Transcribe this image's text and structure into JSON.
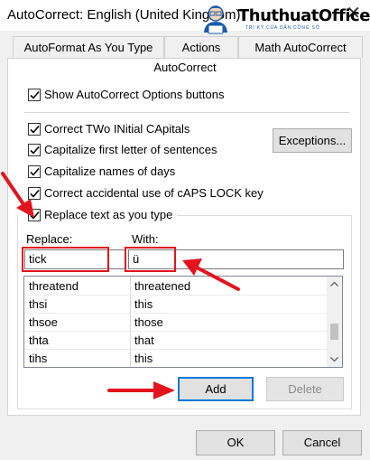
{
  "window": {
    "title": "AutoCorrect: English (United Kingdom)",
    "close_glyph": "✕"
  },
  "watermark": {
    "brand": "ThuthuatOffice",
    "tagline": "TRI KỶ CỦA DÂN CÔNG SỞ"
  },
  "tabs": [
    {
      "label": "AutoFormat As You Type"
    },
    {
      "label": "Actions"
    },
    {
      "label": "Math AutoCorrect"
    }
  ],
  "active_tab": {
    "label": "AutoCorrect"
  },
  "options": {
    "show_buttons": {
      "label": "Show AutoCorrect Options buttons",
      "checked": true
    },
    "two_initial": {
      "label": "Correct TWo INitial CApitals",
      "checked": true
    },
    "first_letter": {
      "label": "Capitalize first letter of sentences",
      "checked": true
    },
    "days": {
      "label": "Capitalize names of days",
      "checked": true
    },
    "caps_lock": {
      "label": "Correct accidental use of cAPS LOCK key",
      "checked": true
    },
    "replace_text": {
      "label": "Replace text as you type",
      "checked": true
    }
  },
  "buttons": {
    "exceptions": "Exceptions...",
    "add": "Add",
    "delete": "Delete",
    "ok": "OK",
    "cancel": "Cancel"
  },
  "replace": {
    "replace_label": "Replace:",
    "with_label": "With:",
    "replace_value": "tick",
    "with_value": "ü"
  },
  "entries": [
    {
      "replace": "threatend",
      "with": "threatened"
    },
    {
      "replace": "thsi",
      "with": "this"
    },
    {
      "replace": "thsoe",
      "with": "those"
    },
    {
      "replace": "thta",
      "with": "that"
    },
    {
      "replace": "tihs",
      "with": "this"
    }
  ],
  "colors": {
    "annotation_red": "#e3141d",
    "brand_blue": "#1a5aa8",
    "add_button_border": "#0078d7"
  }
}
